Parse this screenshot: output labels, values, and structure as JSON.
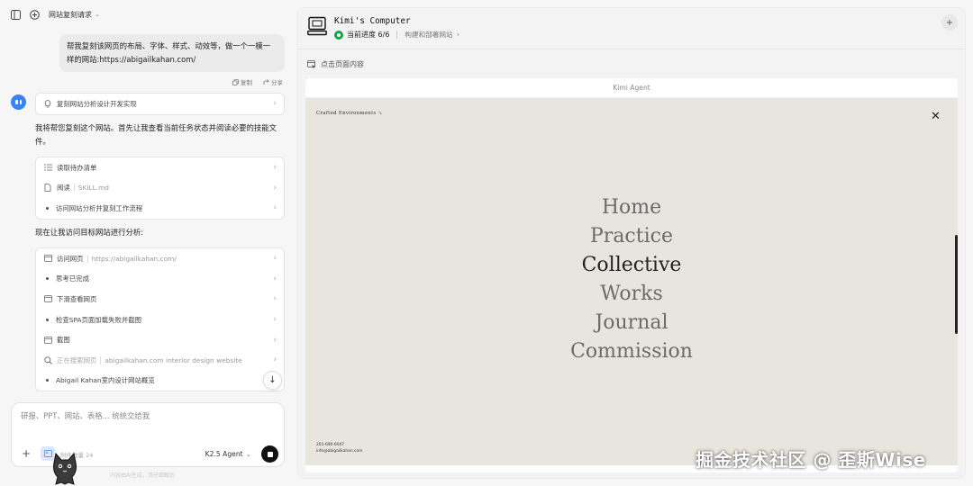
{
  "header": {
    "title": "网站复刻请求"
  },
  "user_message": "帮我复刻该网页的布局、字体、样式、动效等，做一个一模一样的网站:https://abigailkahan.com/",
  "message_actions": {
    "copy": "复制",
    "share": "分享"
  },
  "task_card": {
    "label": "复刻网站分析设计开发实现"
  },
  "para1": "我将帮您复刻这个网站。首先让我查看当前任务状态并阅读必要的技能文件。",
  "steps1": [
    {
      "label": "读取待办清单",
      "sub": ""
    },
    {
      "label": "阅读",
      "sub": "SKILL.md"
    },
    {
      "label": "访问网站分析并复刻工作流程",
      "sub": ""
    }
  ],
  "para2": "现在让我访问目标网站进行分析:",
  "steps2": [
    {
      "label": "访问网页",
      "sub": "https://abigailkahan.com/"
    },
    {
      "label": "思考已完成",
      "sub": ""
    },
    {
      "label": "下滑查看网页",
      "sub": ""
    },
    {
      "label": "检查SPA页面加载失败并截图",
      "sub": ""
    },
    {
      "label": "截图",
      "sub": ""
    },
    {
      "label": "正在搜索网页",
      "sub": "abigailkahan.com interior design website"
    },
    {
      "label": "Abigail Kahan室内设计网站概览",
      "sub": ""
    }
  ],
  "input": {
    "placeholder": "研报、PPT、网站、表格... 统统交给我",
    "attachment_label": "附件数量 24",
    "model": "K2.5 Agent"
  },
  "footer_note": "内容由AI生成，请仔细甄别",
  "computer": {
    "title": "Kimi's Computer",
    "progress": "当前进度 6/6",
    "task": "构建和部署网站",
    "click_hint": "点击页面内容"
  },
  "browser": {
    "title": "Kimi Agent",
    "site": {
      "brand": "Crafted Environments",
      "close": "✕",
      "nav": [
        "Home",
        "Practice",
        "Collective",
        "Works",
        "Journal",
        "Commission"
      ],
      "active_index": 2,
      "phone": "201-690-6047",
      "email": "info@abigailkahan.com"
    }
  },
  "watermark": "掘金技术社区 @ 歪斯Wise"
}
